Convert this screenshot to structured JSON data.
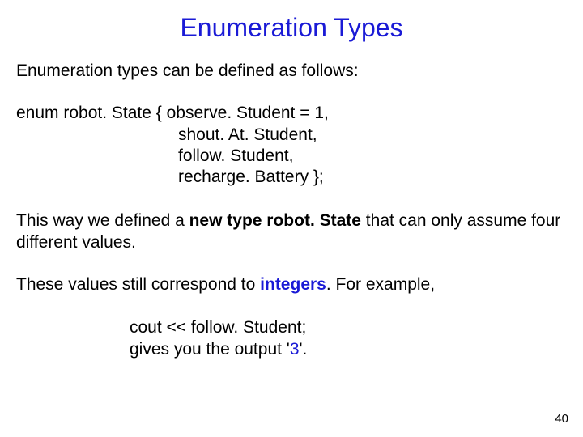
{
  "title": "Enumeration Types",
  "intro": "Enumeration types can be defined as follows:",
  "enum": {
    "l1": "enum robot. State { observe. Student = 1,",
    "l2": "shout. At. Student,",
    "l3": "follow. Student,",
    "l4": "recharge. Battery };"
  },
  "para2": {
    "a": "This way we defined a ",
    "b": "new type robot. State",
    "c": " that can only assume four different values."
  },
  "para3": {
    "a": "These values still correspond to ",
    "b": "integers",
    "c": ". For example,"
  },
  "cout": {
    "l1": "cout << follow. Student;",
    "l2a": "gives you the output '",
    "l2b": "3",
    "l2c": "'."
  },
  "page": "40"
}
